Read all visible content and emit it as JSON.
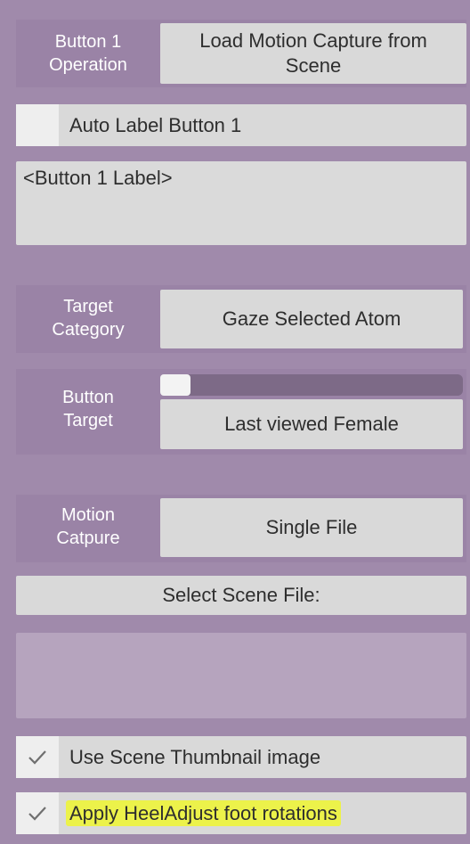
{
  "button1": {
    "operation_label": "Button 1\nOperation",
    "operation_value": "Load Motion Capture from\nScene"
  },
  "auto_label": {
    "label": "Auto Label Button 1",
    "checked": false
  },
  "button_label_field": {
    "value": "<Button 1 Label>"
  },
  "target_category": {
    "label": "Target\nCategory",
    "value": "Gaze Selected Atom"
  },
  "button_target": {
    "label": "Button\nTarget",
    "value": "Last viewed Female",
    "slider_fraction": 0.0
  },
  "motion_capture": {
    "label": "Motion\nCatpure",
    "value": "Single File"
  },
  "select_scene": {
    "label": "Select Scene File:"
  },
  "use_thumbnail": {
    "label": "Use Scene Thumbnail image",
    "checked": true
  },
  "apply_heel": {
    "label": "Apply HeelAdjust foot rotations",
    "checked": true,
    "highlight_color": "#ecf24a"
  },
  "colors": {
    "panel_bg": "#a08aab",
    "button_bg": "#d9d9d9",
    "text_dark": "#2e2e2e",
    "label_text": "#ffffff"
  }
}
